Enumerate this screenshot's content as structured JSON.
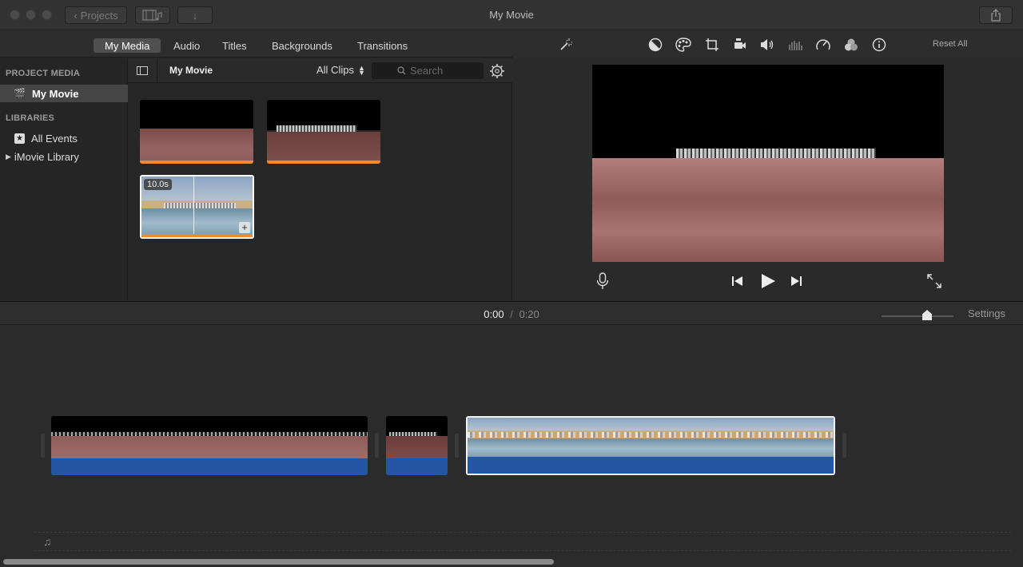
{
  "window": {
    "title": "My Movie",
    "back_label": "Projects"
  },
  "tabs": [
    {
      "label": "My Media",
      "active": true
    },
    {
      "label": "Audio",
      "active": false
    },
    {
      "label": "Titles",
      "active": false
    },
    {
      "label": "Backgrounds",
      "active": false
    },
    {
      "label": "Transitions",
      "active": false
    }
  ],
  "sidebar": {
    "project_media_heading": "PROJECT MEDIA",
    "project_item": "My Movie",
    "libraries_heading": "LIBRARIES",
    "all_events": "All Events",
    "library": "iMovie Library"
  },
  "media": {
    "title": "My Movie",
    "filter": "All Clips",
    "search_placeholder": "Search",
    "selected_clip_duration": "10.0s"
  },
  "viewer": {
    "reset_label": "Reset All",
    "tools": [
      "magic-wand-icon",
      "color-balance-icon",
      "color-correction-icon",
      "crop-icon",
      "stabilization-icon",
      "volume-icon",
      "noise-reduction-icon",
      "speed-icon",
      "filter-icon",
      "info-icon"
    ]
  },
  "timeline": {
    "current_time": "0:00",
    "separator": "/",
    "total_time": "0:20",
    "settings_label": "Settings",
    "zoom_level": 0.65
  },
  "colors": {
    "accent_orange": "#f08a2a",
    "audio_blue": "#2456a6",
    "selection": "#ffffff"
  }
}
